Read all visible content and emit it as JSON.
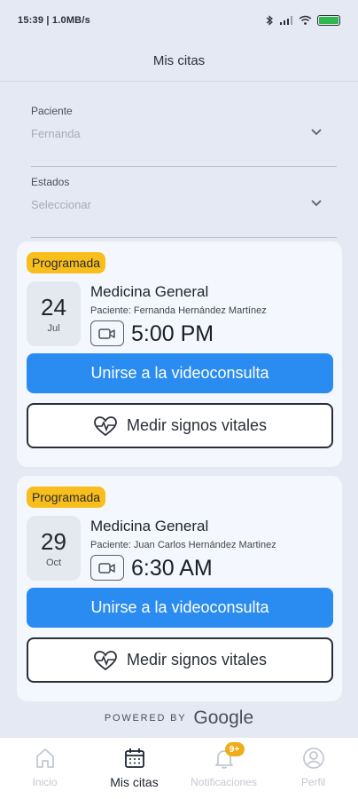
{
  "status_bar": {
    "left_text": "15:39 | 1.0MB/s",
    "battery_level": 1.0,
    "icons": [
      "bluetooth-icon",
      "signal-icon",
      "wifi-icon",
      "battery-icon"
    ]
  },
  "header": {
    "title": "Mis citas"
  },
  "filters": [
    {
      "label": "Paciente",
      "value": "Fernanda"
    },
    {
      "label": "Estados",
      "value": "Seleccionar"
    }
  ],
  "cards": [
    {
      "badge": "Programada",
      "day": "24",
      "month": "Jul",
      "specialty": "Medicina General",
      "patient": "Paciente: Fernanda Hernández Martínez",
      "time": "5:00 PM",
      "join_label": "Unirse a la videoconsulta",
      "vitals_label": "Medir signos vitales"
    },
    {
      "badge": "Programada",
      "day": "29",
      "month": "Oct",
      "specialty": "Medicina General",
      "patient": "Paciente: Juan Carlos Hernández Martinez",
      "time": "6:30 AM",
      "join_label": "Unirse a la videoconsulta",
      "vitals_label": "Medir signos vitales"
    }
  ],
  "powered_by": {
    "text": "POWERED BY",
    "brand": "Google"
  },
  "tabbar": {
    "tabs": [
      {
        "label": "Inicio",
        "icon": "home-icon"
      },
      {
        "label": "Mis citas",
        "icon": "calendar-icon"
      },
      {
        "label": "Notificaciones",
        "icon": "bell-icon",
        "badge": "9+"
      },
      {
        "label": "Perfil",
        "icon": "profile-icon"
      }
    ],
    "active_tab": "Mis citas"
  },
  "colors": {
    "accent": "#2a8cf0",
    "badge": "#f8be1c",
    "notification_badge": "#f0ad1a"
  }
}
